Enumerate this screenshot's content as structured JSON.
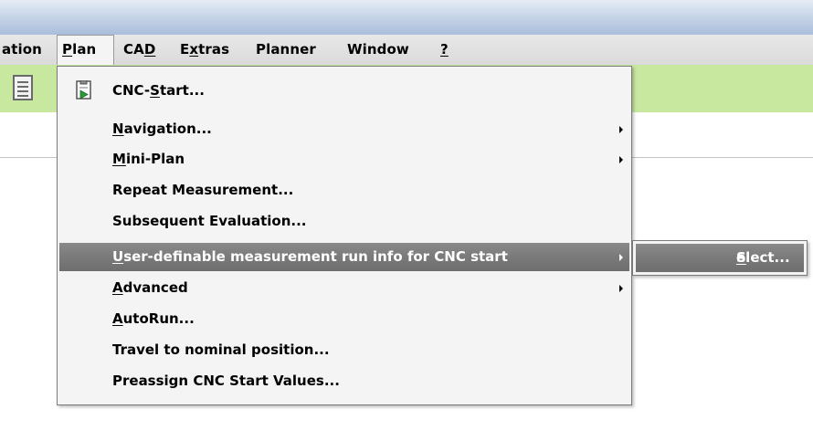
{
  "menubar": {
    "items": [
      {
        "pre": "",
        "u": "",
        "post": "ation"
      },
      {
        "pre": "",
        "u": "P",
        "post": "lan"
      },
      {
        "pre": "CA",
        "u": "D",
        "post": ""
      },
      {
        "pre": "E",
        "u": "x",
        "post": "tras"
      },
      {
        "pre": "Planner",
        "u": "",
        "post": ""
      },
      {
        "pre": "Window",
        "u": "",
        "post": ""
      },
      {
        "pre": "",
        "u": "?",
        "post": ""
      }
    ]
  },
  "plan_menu": {
    "items": [
      {
        "pre": "CNC-",
        "u": "S",
        "post": "tart...",
        "icon": "cnc-start-icon",
        "submenu": false,
        "highlighted": false
      },
      {
        "pre": "",
        "u": "N",
        "post": "avigation...",
        "submenu": true,
        "highlighted": false
      },
      {
        "pre": "",
        "u": "M",
        "post": "ini-Plan",
        "submenu": true,
        "highlighted": false
      },
      {
        "pre": "Repeat Measurement...",
        "u": "",
        "post": "",
        "submenu": false,
        "highlighted": false
      },
      {
        "pre": "Subsequent Evaluation...",
        "u": "",
        "post": "",
        "submenu": false,
        "highlighted": false
      },
      {
        "pre": "",
        "u": "U",
        "post": "ser-definable measurement run info for CNC start",
        "submenu": true,
        "highlighted": true
      },
      {
        "pre": "",
        "u": "A",
        "post": "dvanced",
        "submenu": true,
        "highlighted": false
      },
      {
        "pre": "",
        "u": "A",
        "post": "utoRun...",
        "submenu": false,
        "highlighted": false
      },
      {
        "pre": "Travel to nominal position...",
        "u": "",
        "post": "",
        "submenu": false,
        "highlighted": false
      },
      {
        "pre": "Preassign CNC Start Values...",
        "u": "",
        "post": "",
        "submenu": false,
        "highlighted": false
      }
    ]
  },
  "submenu": {
    "select": {
      "pre": "",
      "u": "S",
      "post": "elect..."
    }
  },
  "colors": {
    "toolbar_bg": "#c8e8a0",
    "highlight_bg": "#7a7a7a",
    "menu_bg": "#f4f4f4"
  }
}
